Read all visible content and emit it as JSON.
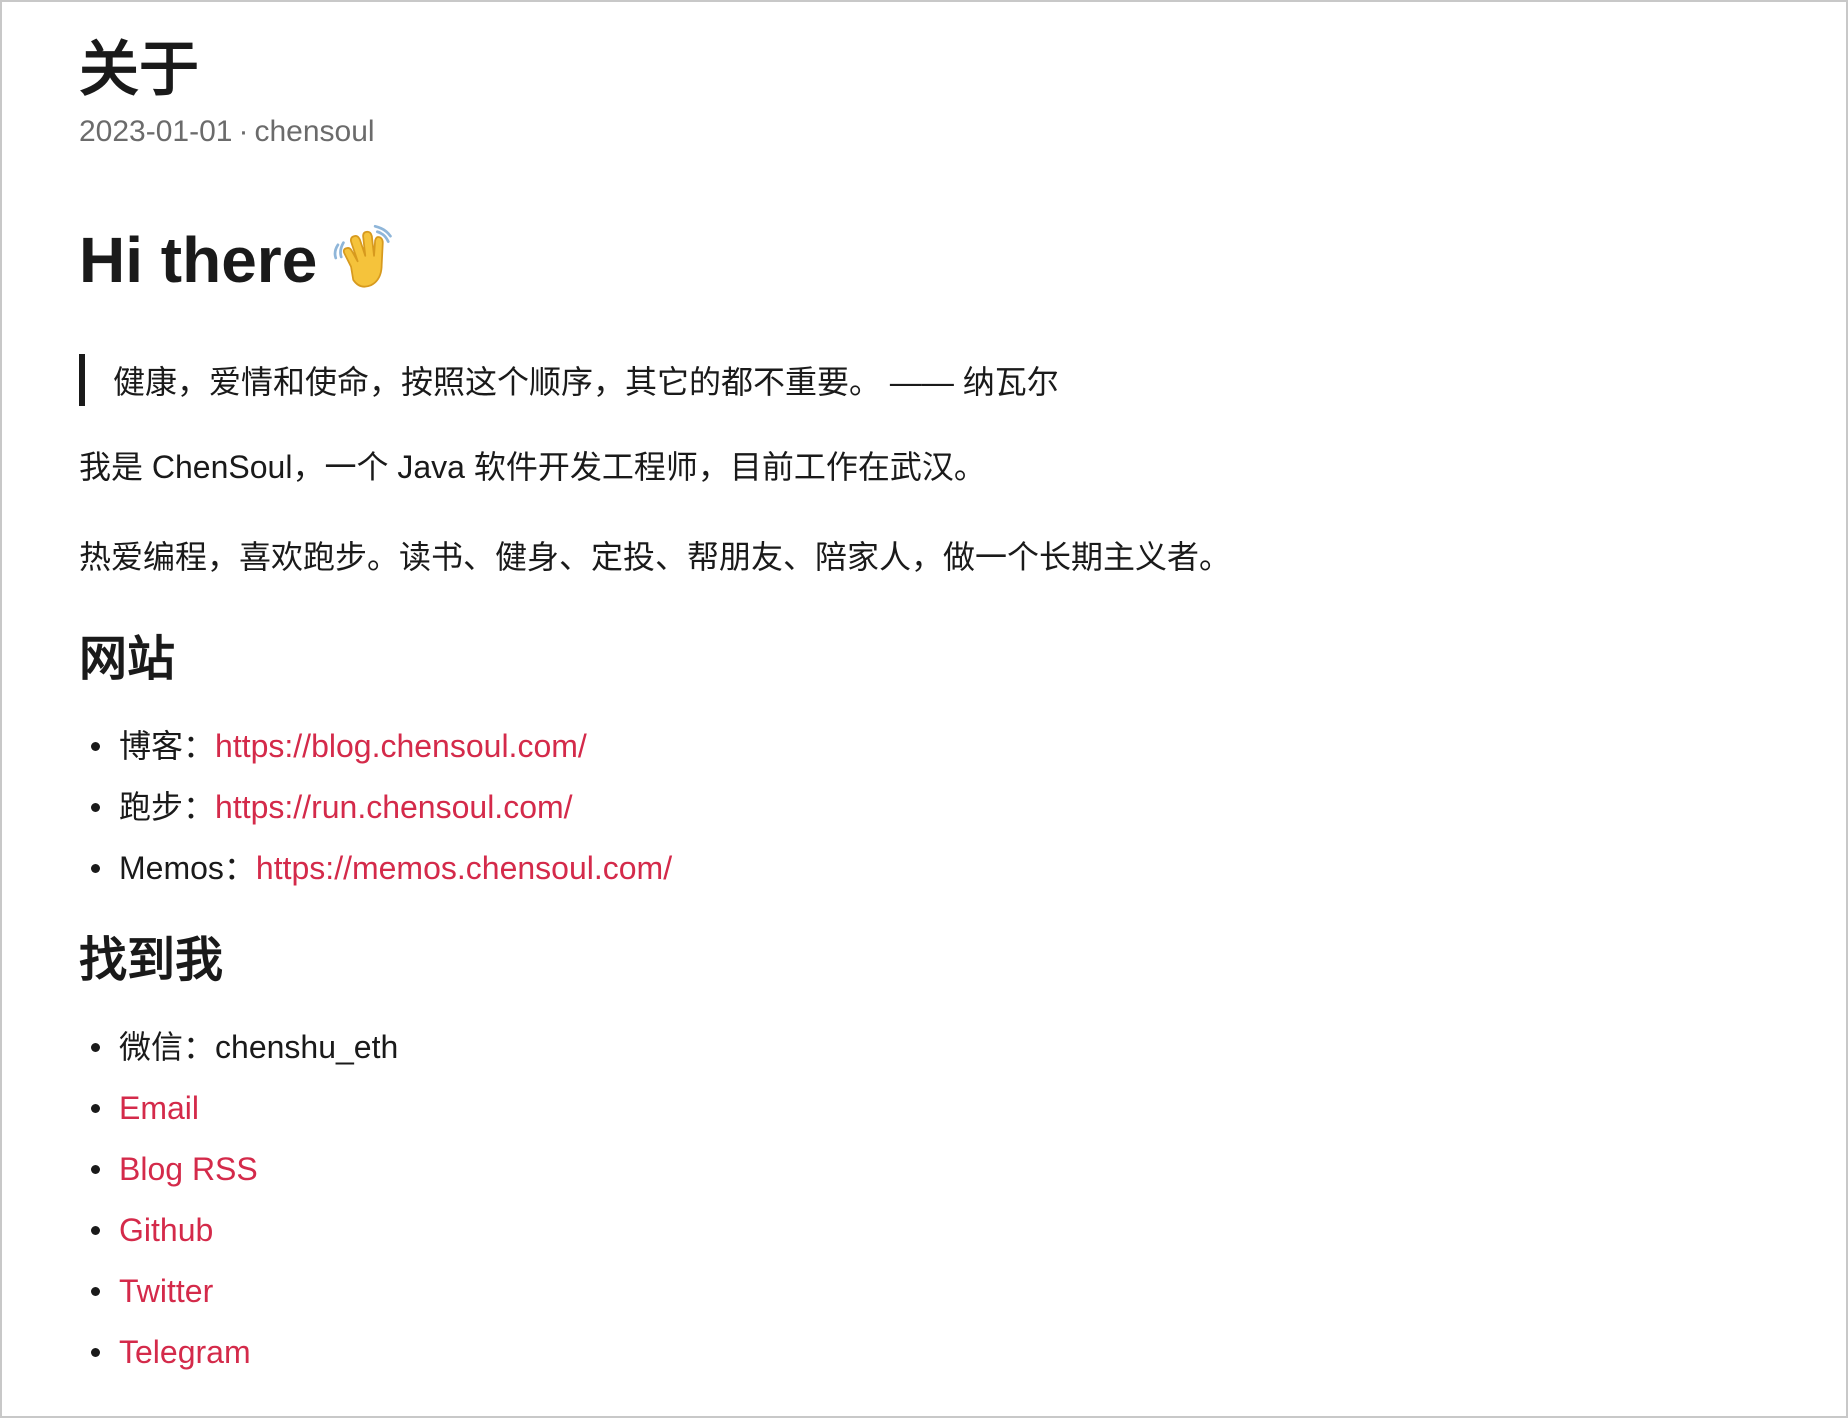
{
  "page": {
    "title": "关于",
    "date": "2023-01-01",
    "separator": "·",
    "author": "chensoul"
  },
  "intro": {
    "heading": "Hi there",
    "heading_icon": "waving-hand-icon",
    "quote": "健康，爱情和使命，按照这个顺序，其它的都不重要。 —— 纳瓦尔",
    "para1": "我是 ChenSoul，一个 Java 软件开发工程师，目前工作在武汉。",
    "para2": "热爱编程，喜欢跑步。读书、健身、定投、帮朋友、陪家人，做一个长期主义者。"
  },
  "websites": {
    "heading": "网站",
    "items": [
      {
        "label": "博客：",
        "link": "https://blog.chensoul.com/"
      },
      {
        "label": "跑步：",
        "link": "https://run.chensoul.com/"
      },
      {
        "label": "Memos：",
        "link": "https://memos.chensoul.com/"
      }
    ]
  },
  "contact": {
    "heading": "找到我",
    "wechat_label": "微信：",
    "wechat_value": "chenshu_eth",
    "links": [
      "Email",
      "Blog RSS",
      "Github",
      "Twitter",
      "Telegram"
    ]
  },
  "colors": {
    "link": "#d42a4a",
    "text": "#1a1a1a",
    "meta": "#6b6b6b"
  }
}
